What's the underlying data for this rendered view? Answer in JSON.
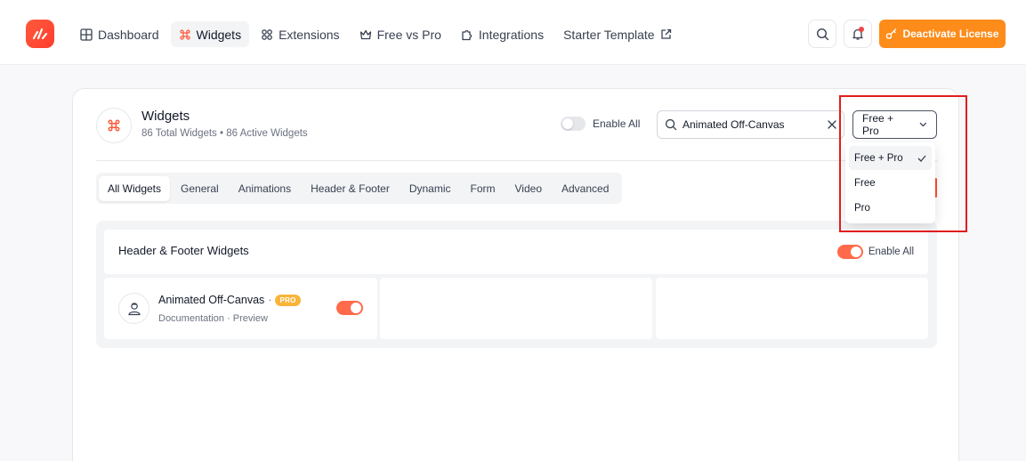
{
  "nav": {
    "items": [
      {
        "label": "Dashboard",
        "icon": "grid-icon"
      },
      {
        "label": "Widgets",
        "icon": "command-icon",
        "active": true
      },
      {
        "label": "Extensions",
        "icon": "extensions-icon"
      },
      {
        "label": "Free vs Pro",
        "icon": "crown-icon"
      },
      {
        "label": "Integrations",
        "icon": "puzzle-icon"
      },
      {
        "label": "Starter Template",
        "icon": "external-link-icon"
      }
    ]
  },
  "header": {
    "license_label": "Deactivate License",
    "accent": "#fd8c1a"
  },
  "widgets": {
    "title": "Widgets",
    "total_label": "86 Total Widgets",
    "bullet": "•",
    "active_label": "86 Active Widgets",
    "enable_all_label": "Enable All",
    "search_value": "Animated Off-Canvas",
    "filter_value": "Free + Pro"
  },
  "tabs": [
    {
      "label": "All Widgets",
      "active": true
    },
    {
      "label": "General"
    },
    {
      "label": "Animations"
    },
    {
      "label": "Header & Footer"
    },
    {
      "label": "Dynamic"
    },
    {
      "label": "Form"
    },
    {
      "label": "Video"
    },
    {
      "label": "Advanced"
    }
  ],
  "section": {
    "title": "Header & Footer Widgets",
    "enable_all_label": "Enable All",
    "enabled": true
  },
  "widget_card": {
    "name": "Animated Off-Canvas",
    "separator": "·",
    "badge": "PRO",
    "doc_label": "Documentation",
    "link_sep": "·",
    "preview_label": "Preview",
    "enabled": true
  },
  "dropdown": {
    "options": [
      {
        "label": "Free + Pro",
        "selected": true
      },
      {
        "label": "Free"
      },
      {
        "label": "Pro"
      }
    ]
  },
  "colors": {
    "toggle_on": "#ff6a4a",
    "highlight_box": "#e11d1d",
    "pro_badge": "#f9b43a"
  }
}
